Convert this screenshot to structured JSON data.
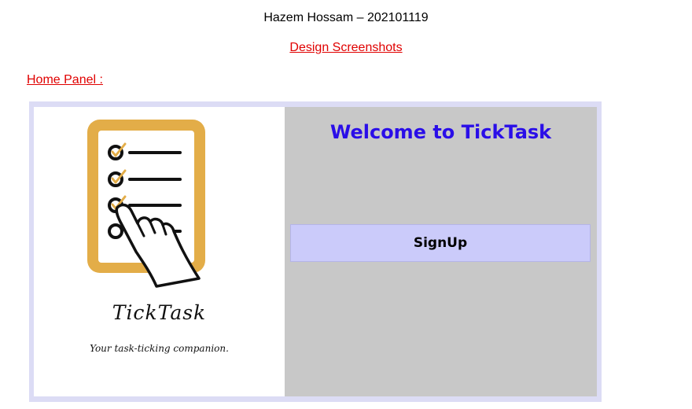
{
  "document": {
    "author": "Hazem Hossam – 202101119",
    "subtitle": "Design Screenshots",
    "section_label": "Home Panel :"
  },
  "app": {
    "brand_name": "TickTask",
    "tagline": "Your task-ticking companion.",
    "welcome_title": "Welcome to TickTask",
    "signup_label": "SignUp"
  },
  "colors": {
    "accent_red": "#e00000",
    "title_blue": "#2a0ee8",
    "right_panel_gray": "#c8c8c8",
    "button_lavender": "#cbcbfa",
    "frame_lavender": "#dcdcf5",
    "logo_gold": "#e3ad48"
  },
  "icons": {
    "logo": "checklist-clipboard-with-pointing-hand-icon"
  }
}
